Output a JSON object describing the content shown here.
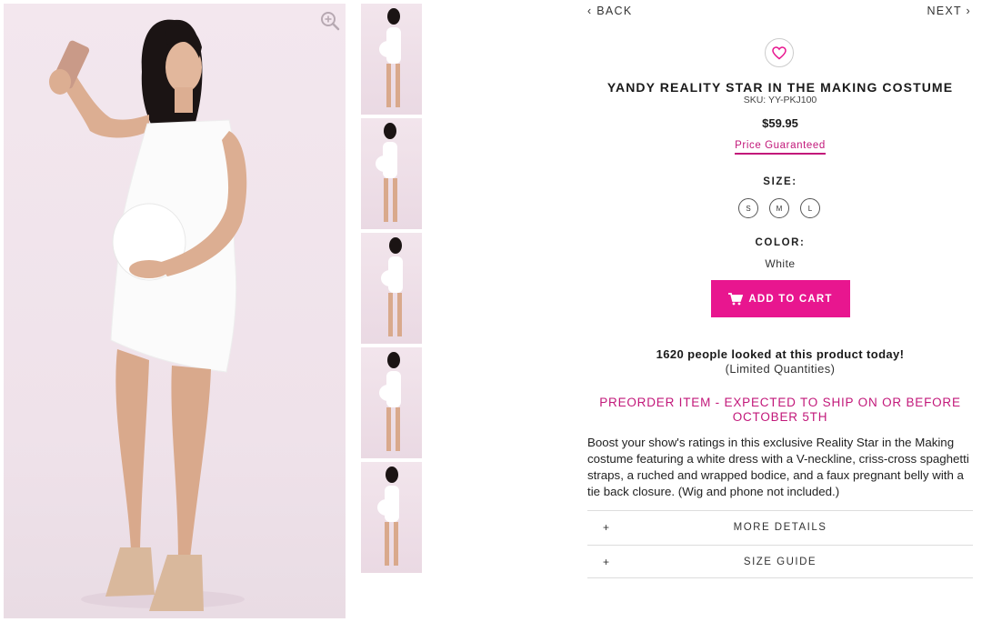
{
  "gallery": {
    "main_image_alt": "model in white dress taking a selfie",
    "thumbnail_count": 5,
    "zoom_icon": "zoom-in-icon"
  },
  "nav": {
    "back_label": "‹ BACK",
    "next_label": "NEXT ›"
  },
  "product": {
    "title": "YANDY REALITY STAR IN THE MAKING COSTUME",
    "sku": "SKU: YY-PKJ100",
    "price": "$59.95",
    "price_guarantee": "Price Guaranteed",
    "size_label": "SIZE:",
    "sizes": [
      "S",
      "M",
      "L"
    ],
    "color_label": "COLOR:",
    "color_value": "White",
    "add_to_cart_label": "ADD TO CART",
    "viewers_text": "1620 people looked at this product today!",
    "limited_text": "(Limited Quantities)",
    "preorder_text": "PREORDER ITEM - EXPECTED TO SHIP ON OR BEFORE OCTOBER 5TH",
    "description": "Boost your show's ratings in this exclusive Reality Star in the Making costume featuring a white dress with a V-neckline, criss-cross spaghetti straps, a ruched and wrapped bodice, and a faux pregnant belly with a tie back closure. (Wig and phone not included.)"
  },
  "accordions": [
    {
      "label": "MORE DETAILS",
      "icon": "+"
    },
    {
      "label": "SIZE GUIDE",
      "icon": "+"
    }
  ],
  "colors": {
    "accent": "#e8168f",
    "accent_text": "#c2187a"
  }
}
